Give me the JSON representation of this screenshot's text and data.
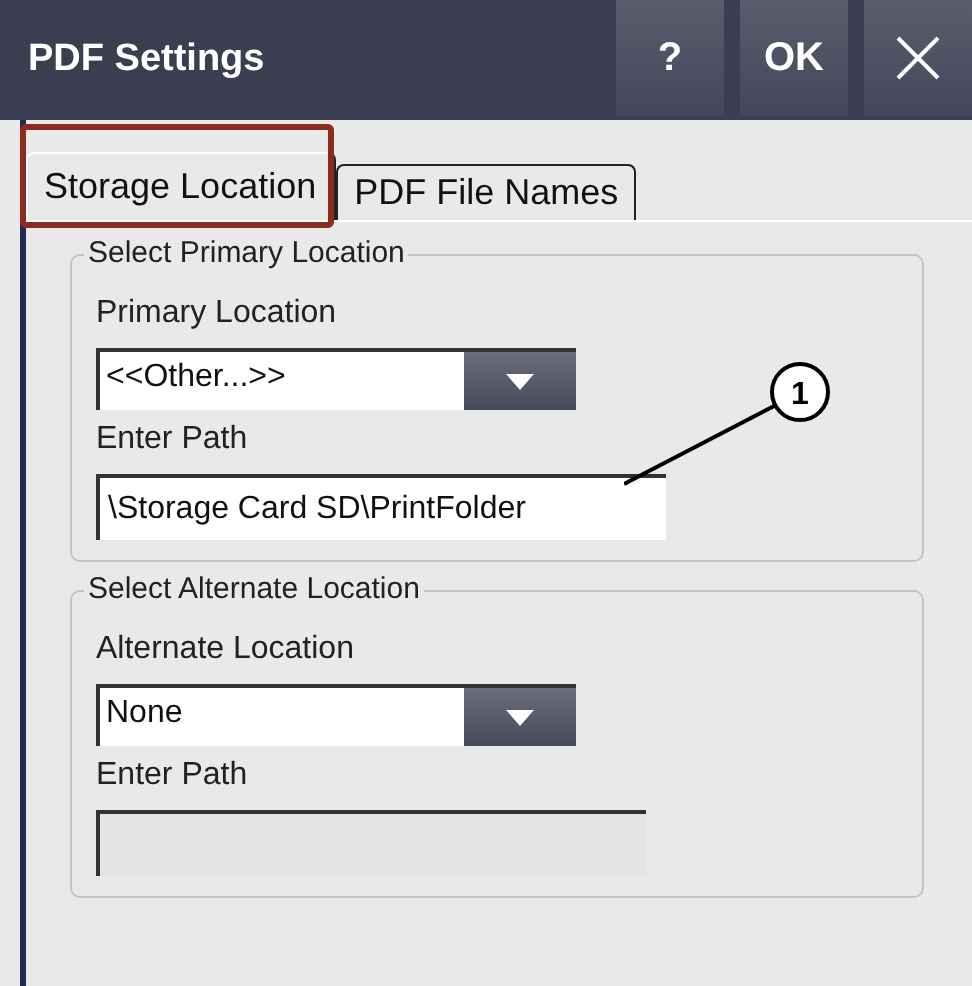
{
  "window": {
    "title": "PDF Settings"
  },
  "title_buttons": [
    {
      "kind": "help",
      "label": "?"
    },
    {
      "kind": "ok",
      "label": "OK"
    },
    {
      "kind": "close"
    }
  ],
  "tabs": [
    {
      "label": "Storage Location",
      "selected": true
    },
    {
      "label": "PDF File Names",
      "selected": false
    }
  ],
  "groups": [
    {
      "title": "Select Primary Location",
      "dropdown_label": "Primary Location",
      "dropdown_value": "<<Other...>>",
      "path_label": "Enter Path",
      "path_value": "\\Storage Card SD\\PrintFolder",
      "path_disabled": false
    },
    {
      "title": "Select Alternate Location",
      "dropdown_label": "Alternate Location",
      "dropdown_value": "None",
      "path_label": "Enter Path",
      "path_disabled": true
    }
  ],
  "callout": {
    "label": "1"
  }
}
